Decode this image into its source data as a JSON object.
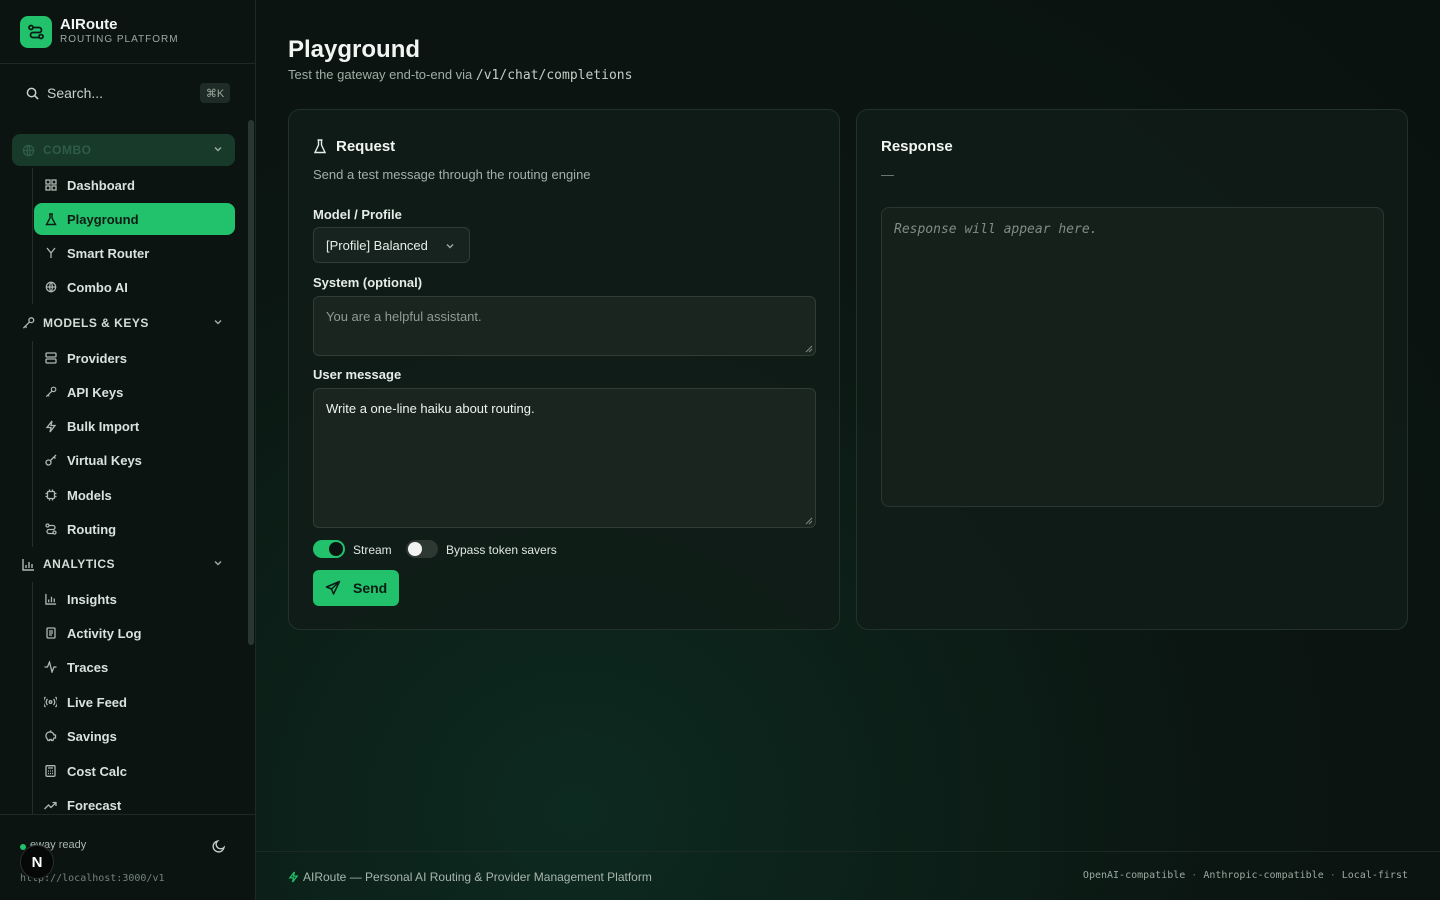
{
  "brand": {
    "name": "AIRoute",
    "subtitle": "ROUTING PLATFORM"
  },
  "search": {
    "label": "Search...",
    "shortcut": "⌘K"
  },
  "sidebar": {
    "groups": [
      {
        "label": "COMBO",
        "icon": "globe-icon",
        "collapsed": true,
        "items": [
          {
            "label": "Dashboard",
            "icon": "dashboard-icon"
          },
          {
            "label": "Playground",
            "icon": "flask-icon",
            "active": true
          },
          {
            "label": "Smart Router",
            "icon": "split-icon"
          },
          {
            "label": "Combo AI",
            "icon": "globe-icon"
          }
        ]
      },
      {
        "label": "MODELS & KEYS",
        "icon": "key-icon",
        "items": [
          {
            "label": "Providers",
            "icon": "server-icon"
          },
          {
            "label": "API Keys",
            "icon": "key-icon"
          },
          {
            "label": "Bulk Import",
            "icon": "bolt-icon"
          },
          {
            "label": "Virtual Keys",
            "icon": "key-round-icon"
          },
          {
            "label": "Models",
            "icon": "chip-icon"
          },
          {
            "label": "Routing",
            "icon": "route-icon"
          }
        ]
      },
      {
        "label": "ANALYTICS",
        "icon": "bar-chart-icon",
        "items": [
          {
            "label": "Insights",
            "icon": "bar-chart-icon"
          },
          {
            "label": "Activity Log",
            "icon": "log-icon"
          },
          {
            "label": "Traces",
            "icon": "pulse-icon"
          },
          {
            "label": "Live Feed",
            "icon": "radio-icon"
          },
          {
            "label": "Savings",
            "icon": "piggy-icon"
          },
          {
            "label": "Cost Calc",
            "icon": "calculator-icon"
          },
          {
            "label": "Forecast",
            "icon": "trend-icon"
          }
        ]
      }
    ],
    "footer": {
      "status": "eway ready",
      "endpoint": "http://localhost:3000/v1",
      "avatar": "N"
    }
  },
  "page": {
    "title": "Playground",
    "subtitle": "Test the gateway end-to-end via",
    "endpoint": "/v1/chat/completions"
  },
  "request": {
    "title": "Request",
    "description": "Send a test message through the routing engine",
    "model_label": "Model / Profile",
    "model_value": "[Profile] Balanced",
    "system_label": "System (optional)",
    "system_placeholder": "You are a helpful assistant.",
    "user_label": "User message",
    "user_value": "Write a one-line haiku about routing.",
    "stream_label": "Stream",
    "stream_on": true,
    "bypass_label": "Bypass token savers",
    "bypass_on": false,
    "send_label": "Send"
  },
  "response": {
    "title": "Response",
    "meta": "—",
    "placeholder": "Response will appear here."
  },
  "footer": {
    "text": "AIRoute — Personal AI Routing & Provider Management Platform",
    "tags": [
      "OpenAI-compatible",
      "Anthropic-compatible",
      "Local-first"
    ]
  },
  "colors": {
    "accent": "#22c16b",
    "background": "#0b1411",
    "card": "#101c17"
  }
}
